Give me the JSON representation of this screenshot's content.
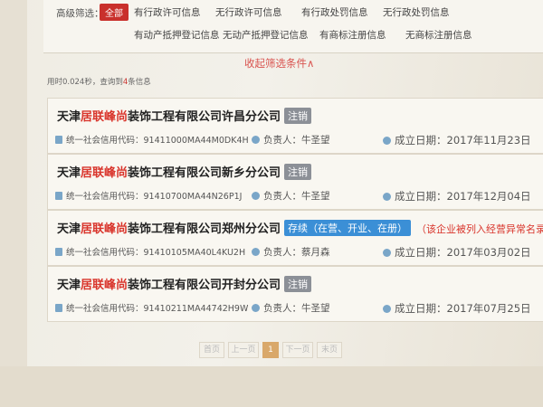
{
  "filters": {
    "label": "高级筛选：",
    "active_chip": "全部",
    "row1": [
      "有行政许可信息",
      "无行政许可信息",
      "有行政处罚信息",
      "无行政处罚信息"
    ],
    "row2": [
      "有动产抵押登记信息",
      "无动产抵押登记信息",
      "有商标注册信息",
      "无商标注册信息"
    ],
    "collapse_label": "收起筛选条件∧"
  },
  "results": {
    "info_prefix": "用时0.024秒，查询到",
    "count": "4",
    "info_suffix": "条信息"
  },
  "companies": [
    {
      "name_prefix": "天津",
      "name_highlight": "居联峰尚",
      "name_suffix": "装饰工程有限公司许昌分公司",
      "status": "注销",
      "code_label": "统一社会信用代码：",
      "code": "91411000MA44M0DK4H",
      "person_label": "负责人：",
      "person": "牛圣望",
      "date_label": "成立日期：",
      "date": "2017年11月23日",
      "warning": ""
    },
    {
      "name_prefix": "天津",
      "name_highlight": "居联峰尚",
      "name_suffix": "装饰工程有限公司新乡分公司",
      "status": "注销",
      "code_label": "统一社会信用代码：",
      "code": "91410700MA44N26P1J",
      "person_label": "负责人：",
      "person": "牛圣望",
      "date_label": "成立日期：",
      "date": "2017年12月04日",
      "warning": ""
    },
    {
      "name_prefix": "天津",
      "name_highlight": "居联峰尚",
      "name_suffix": "装饰工程有限公司郑州分公司",
      "status": "存续（在营、开业、在册）",
      "code_label": "统一社会信用代码：",
      "code": "91410105MA40L4KU2H",
      "person_label": "负责人：",
      "person": "蔡月森",
      "date_label": "成立日期：",
      "date": "2017年03月02日",
      "warning": "（该企业被列入经营异常名录）"
    },
    {
      "name_prefix": "天津",
      "name_highlight": "居联峰尚",
      "name_suffix": "装饰工程有限公司开封分公司",
      "status": "注销",
      "code_label": "统一社会信用代码：",
      "code": "91410211MA44742H9W",
      "person_label": "负责人：",
      "person": "牛圣望",
      "date_label": "成立日期：",
      "date": "2017年07月25日",
      "warning": ""
    }
  ],
  "pagination": {
    "first": "首页",
    "prev": "上一页",
    "current": "1",
    "next": "下一页",
    "last": "末页"
  },
  "colors": {
    "highlight": "#d9342b",
    "status_cancelled": "#8c9097",
    "status_active": "#3b8fd6"
  }
}
